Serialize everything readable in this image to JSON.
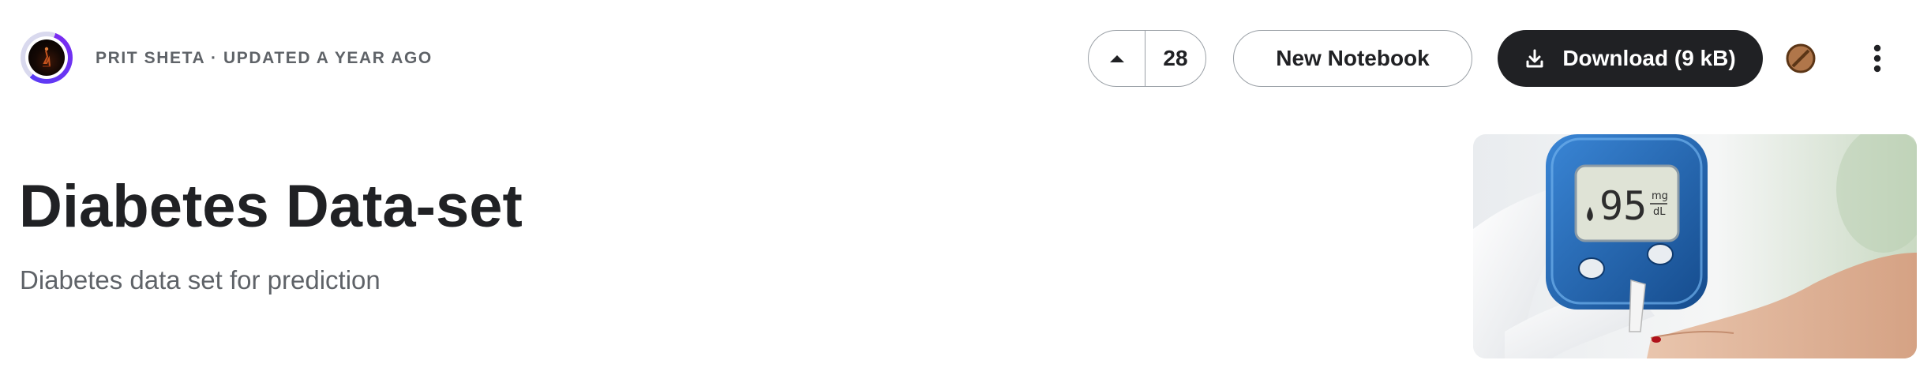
{
  "header": {
    "author": "PRIT SHETA",
    "separator": "·",
    "updated": "UPDATED A YEAR AGO"
  },
  "actions": {
    "upvote_count": "28",
    "new_notebook_label": "New Notebook",
    "download_label": "Download (9 kB)"
  },
  "dataset": {
    "title": "Diabetes Data-set",
    "subtitle": "Diabetes data set for prediction"
  },
  "cover": {
    "meter_reading": "95",
    "meter_unit_top": "mg",
    "meter_unit_bottom": "dL"
  },
  "icons": {
    "upvote": "caret-up-icon",
    "download": "download-icon",
    "dataset_badge": "dataset-badge-icon",
    "more": "more-vertical-icon"
  },
  "colors": {
    "primary_dark": "#202124",
    "muted_text": "#5f6368",
    "avatar_ring": "#6b33f2",
    "border": "#9aa0a6",
    "meter_blue": "#1f5fa8"
  }
}
